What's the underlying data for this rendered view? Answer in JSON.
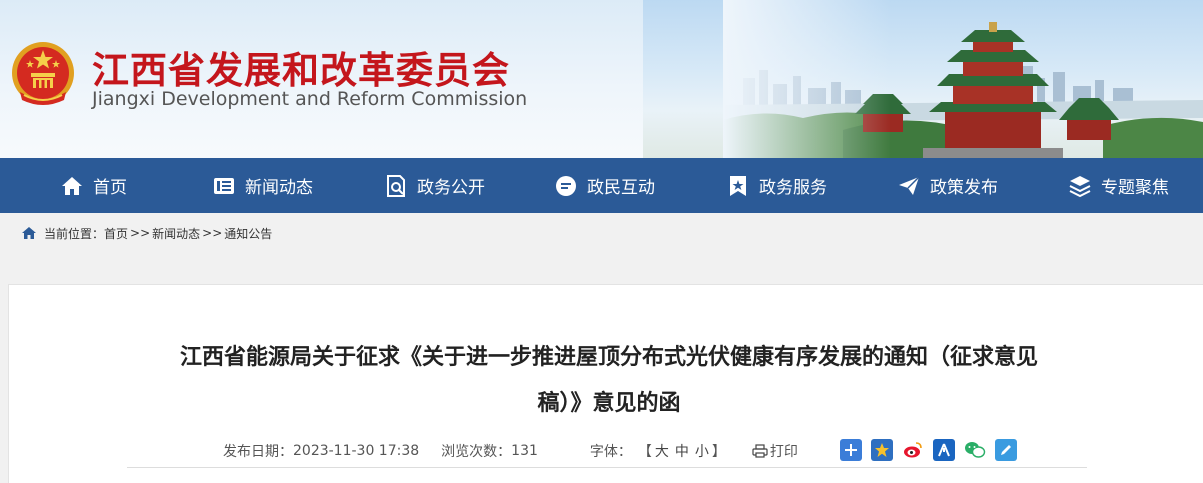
{
  "header": {
    "title": "江西省发展和改革委员会",
    "subtitle": "Jiangxi Development and Reform Commission",
    "brand_color": "#c4161c"
  },
  "nav": {
    "bg_color": "#2b5a97",
    "items": [
      {
        "label": "首页",
        "icon": "home-icon"
      },
      {
        "label": "新闻动态",
        "icon": "news-icon"
      },
      {
        "label": "政务公开",
        "icon": "search-doc-icon"
      },
      {
        "label": "政民互动",
        "icon": "chat-icon"
      },
      {
        "label": "政务服务",
        "icon": "star-bookmark-icon"
      },
      {
        "label": "政策发布",
        "icon": "paper-plane-icon"
      },
      {
        "label": "专题聚焦",
        "icon": "layers-icon"
      }
    ]
  },
  "breadcrumb": {
    "prefix": "当前位置：",
    "items": [
      "首页",
      "新闻动态",
      "通知公告"
    ],
    "separator": ">>"
  },
  "article": {
    "title_line1": "江西省能源局关于征求《关于进一步推进屋顶分布式光伏健康有序发展的通知（征求意见",
    "title_line2": "稿）》意见的函",
    "date_label": "发布日期：",
    "date": "2023-11-30 17:38",
    "views_label": "浏览次数：",
    "views": "131",
    "font_label": "字体：",
    "font_open": "【",
    "font_large": "大",
    "font_medium": "中",
    "font_small": "小",
    "font_close": "】",
    "print_label": "打印"
  },
  "share": [
    "plus-share-icon",
    "qzone-star-icon",
    "weibo-icon",
    "renren-icon",
    "wechat-icon",
    "edit-icon"
  ]
}
